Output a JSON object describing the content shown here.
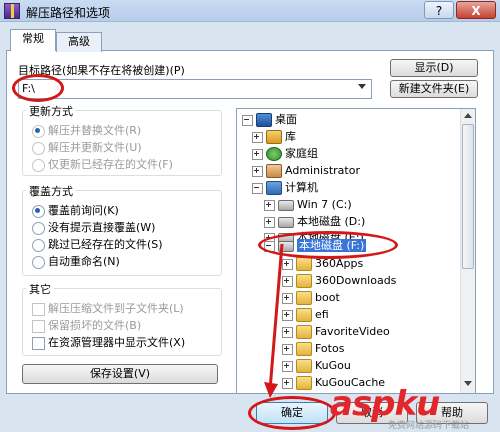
{
  "window": {
    "title": "解压路径和选项",
    "help_label": "?",
    "close_label": "X",
    "icon": "winrar-icon"
  },
  "tabs": [
    {
      "label": "常规",
      "active": true
    },
    {
      "label": "高级",
      "active": false
    }
  ],
  "destination": {
    "label": "目标路径(如果不存在将被创建)(P)",
    "value": "F:\\",
    "show_button": "显示(D)",
    "new_folder_button": "新建文件夹(E)"
  },
  "update_mode": {
    "title": "更新方式",
    "options": [
      {
        "label": "解压并替换文件(R)",
        "selected": true
      },
      {
        "label": "解压并更新文件(U)",
        "selected": false
      },
      {
        "label": "仅更新已经存在的文件(F)",
        "selected": false
      }
    ]
  },
  "overwrite_mode": {
    "title": "覆盖方式",
    "options": [
      {
        "label": "覆盖前询问(K)",
        "selected": true
      },
      {
        "label": "没有提示直接覆盖(W)",
        "selected": false
      },
      {
        "label": "跳过已经存在的文件(S)",
        "selected": false
      },
      {
        "label": "自动重命名(N)",
        "selected": false
      }
    ]
  },
  "misc": {
    "title": "其它",
    "options": [
      {
        "label": "解压压缩文件到子文件夹(L)",
        "checked": false
      },
      {
        "label": "保留损坏的文件(B)",
        "checked": false
      },
      {
        "label": "在资源管理器中显示文件(X)",
        "checked": false
      }
    ]
  },
  "save_settings_button": "保存设置(V)",
  "tree": {
    "nodes": [
      {
        "label": "桌面",
        "icon": "desktop-icon",
        "expander": "minus"
      },
      {
        "label": "库",
        "icon": "library-icon",
        "expander": "plus"
      },
      {
        "label": "家庭组",
        "icon": "homegroup-icon",
        "expander": "plus"
      },
      {
        "label": "Administrator",
        "icon": "user-folder-icon",
        "expander": "plus"
      },
      {
        "label": "计算机",
        "icon": "computer-icon",
        "expander": "minus"
      },
      {
        "label": "Win 7 (C:)",
        "icon": "drive-icon",
        "expander": "plus"
      },
      {
        "label": "本地磁盘 (D:)",
        "icon": "drive-icon",
        "expander": "plus"
      },
      {
        "label": "本地磁盘 (E:)",
        "icon": "drive-icon",
        "expander": "plus"
      },
      {
        "label": "本地磁盘 (F:)",
        "icon": "drive-icon",
        "expander": "minus",
        "selected": true
      },
      {
        "label": "360Apps",
        "icon": "folder-icon",
        "expander": "plus"
      },
      {
        "label": "360Downloads",
        "icon": "folder-icon",
        "expander": "plus"
      },
      {
        "label": "boot",
        "icon": "folder-icon",
        "expander": "plus"
      },
      {
        "label": "efi",
        "icon": "folder-icon",
        "expander": "plus"
      },
      {
        "label": "FavoriteVideo",
        "icon": "folder-icon",
        "expander": "plus"
      },
      {
        "label": "Fotos",
        "icon": "folder-icon",
        "expander": "plus"
      },
      {
        "label": "KuGou",
        "icon": "folder-icon",
        "expander": "plus"
      },
      {
        "label": "KuGouCache",
        "icon": "folder-icon",
        "expander": "plus"
      }
    ]
  },
  "buttons": {
    "ok": "确定",
    "cancel": "取消",
    "help": "帮助"
  },
  "watermark": {
    "text": "aspku",
    "sub": "免费网站源码下载站"
  },
  "colors": {
    "annotation": "#d31818",
    "selection": "#3875d7"
  }
}
